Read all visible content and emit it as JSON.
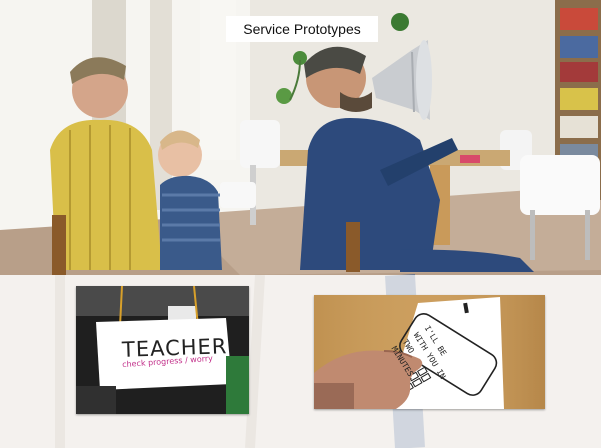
{
  "slide": {
    "title": "Service Prototypes"
  },
  "photos": {
    "main_alt": "",
    "sign": {
      "word": "TEACHER",
      "note": "check progress / worry"
    },
    "phone": {
      "message": "I'LL BE\nWITH YOU IN\nTWO\nMINUTES."
    }
  },
  "colors": {
    "wall": "#e9e6df",
    "floor": "#b59c86",
    "yellow_shirt": "#d9bf49",
    "blue_shirt": "#2d4a7c",
    "child_sweater": "#3a5a8a",
    "wood_table": "#c99a5a",
    "sign_card": "#ffffff",
    "sign_note": "#c2308a"
  }
}
